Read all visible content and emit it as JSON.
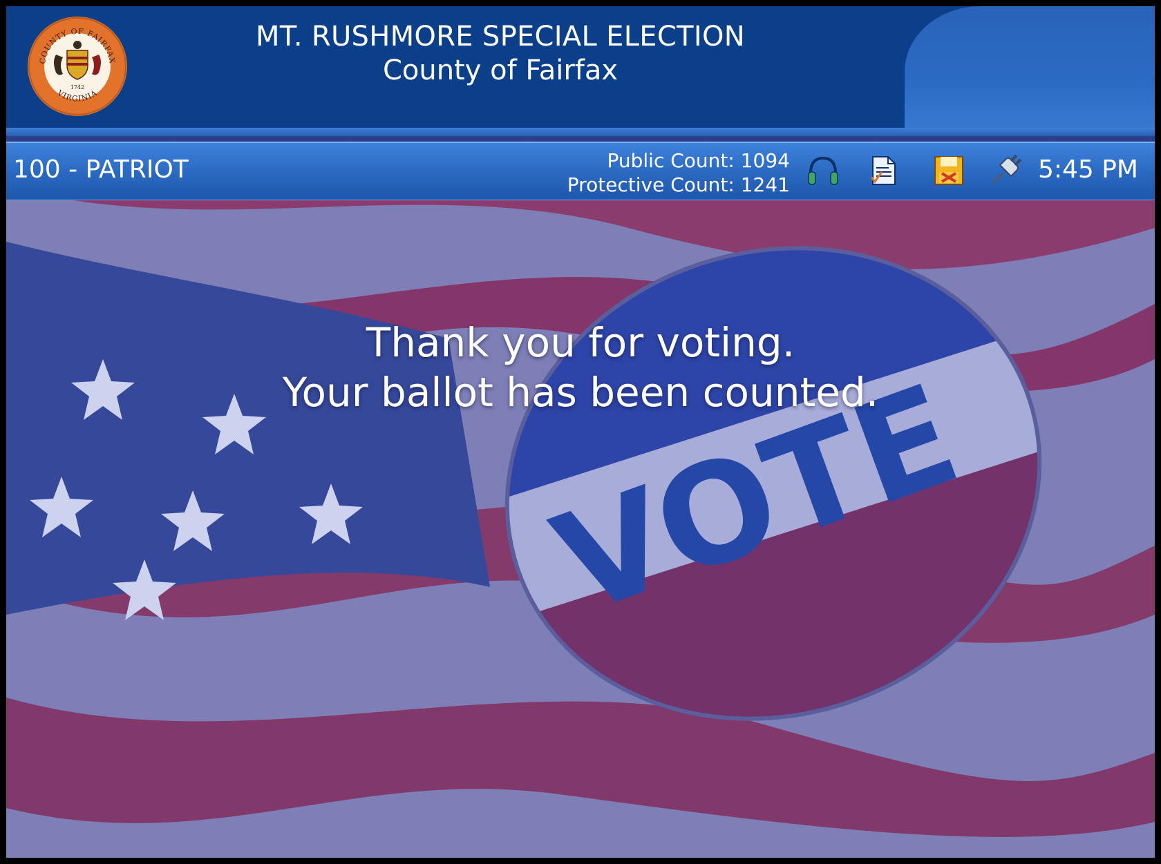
{
  "header": {
    "title": "MT. RUSHMORE SPECIAL ELECTION",
    "subtitle": "County of Fairfax",
    "seal": {
      "top_text": "COUNTY OF FAIRFAX",
      "bottom_text": "VIRGINIA",
      "year": "1742"
    }
  },
  "statusbar": {
    "precinct": "100 - PATRIOT",
    "public_count_label": "Public Count: 1094",
    "protective_count_label": "Protective Count: 1241",
    "icons": [
      "headphones-icon",
      "ballot-document-icon",
      "memory-card-icon",
      "power-plug-icon"
    ],
    "time": "5:45 PM"
  },
  "main": {
    "message_line1": "Thank you for voting.",
    "message_line2": "Your ballot has been counted.",
    "background_badge_text": "VOTE"
  },
  "colors": {
    "header_blue": "#0b3f89",
    "statusbar_blue": "#2a68c0",
    "seal_orange": "#e3732b"
  }
}
